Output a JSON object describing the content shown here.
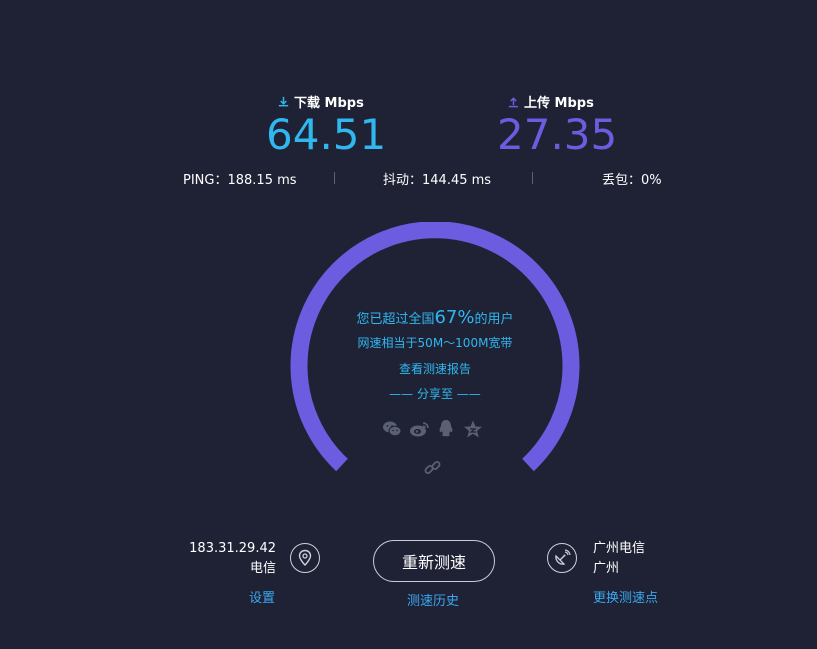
{
  "download": {
    "label": "下载 Mbps",
    "value": "64.51",
    "color": "#2fb7ee",
    "icon": "download-icon"
  },
  "upload": {
    "label": "上传 Mbps",
    "value": "27.35",
    "color": "#6b5ce0",
    "icon": "upload-icon"
  },
  "stats": {
    "ping": "PING：188.15 ms",
    "jitter": "抖动：144.45 ms",
    "loss": "丢包：0%"
  },
  "gauge": {
    "color": "#6b5ce0",
    "line1_prefix": "您已超过全国",
    "percent": "67%",
    "line1_suffix": "的用户",
    "line2": "网速相当于50M～100M宽带",
    "report_link": "查看测速报告",
    "share_label": "—— 分享至 ——",
    "share_icons": [
      "wechat-icon",
      "weibo-icon",
      "qq-icon",
      "qzone-icon"
    ],
    "copy_link_icon": "link-icon"
  },
  "client": {
    "ip": "183.31.29.42",
    "isp": "电信",
    "settings_link": "设置",
    "icon": "location-pin-icon"
  },
  "retest_button": "重新测速",
  "history_link": "测速历史",
  "server": {
    "name": "广州电信",
    "city": "广州",
    "change_link": "更换测速点",
    "icon": "satellite-dish-icon"
  }
}
